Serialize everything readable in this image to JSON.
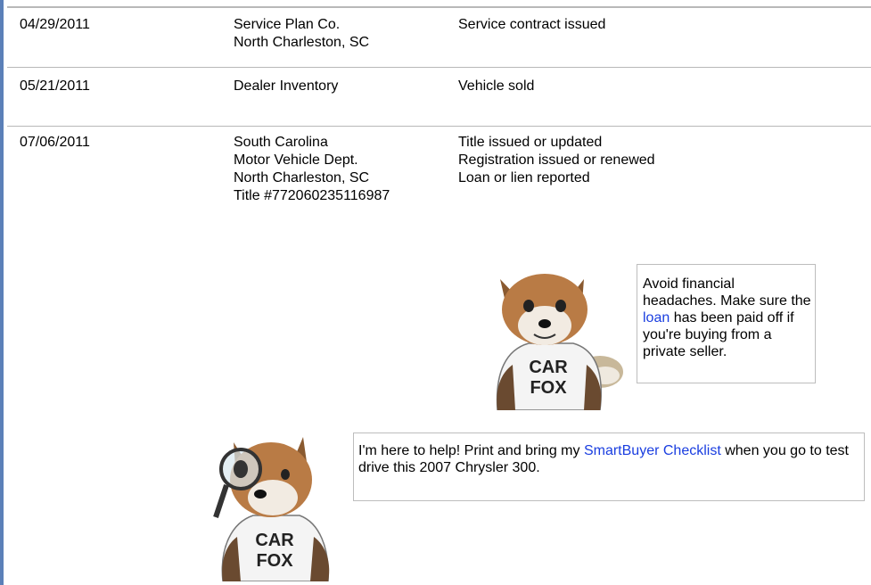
{
  "records": [
    {
      "date": "04/29/2011",
      "source": [
        "Service Plan Co.",
        "North Charleston, SC"
      ],
      "events": [
        "Service contract issued"
      ]
    },
    {
      "date": "05/21/2011",
      "source": [
        "Dealer Inventory"
      ],
      "events": [
        "Vehicle sold"
      ]
    },
    {
      "date": "07/06/2011",
      "source": [
        "South Carolina",
        "Motor Vehicle Dept.",
        "North Charleston, SC",
        "Title #772060235116987"
      ],
      "events": [
        "Title issued or updated",
        "Registration issued or renewed",
        "Loan or lien reported"
      ]
    }
  ],
  "tip_loan": {
    "before": "Avoid financial headaches. Make sure the ",
    "link": "loan",
    "after": " has been paid off if you're buying from a private seller."
  },
  "tip_checklist": {
    "before": "I'm here to help! Print and bring my ",
    "link": "SmartBuyer Checklist",
    "after": " when you go to test drive this 2007 Chrysler 300."
  },
  "fox_shirt": [
    "CAR",
    "FOX"
  ],
  "colors": {
    "accent_bar": "#5b80b8",
    "link": "#1a3ee0",
    "rule": "#b8b8b8"
  },
  "icons": {
    "fox_1": "carfox-mascot-icon",
    "fox_2": "carfox-magnifier-mascot-icon"
  }
}
